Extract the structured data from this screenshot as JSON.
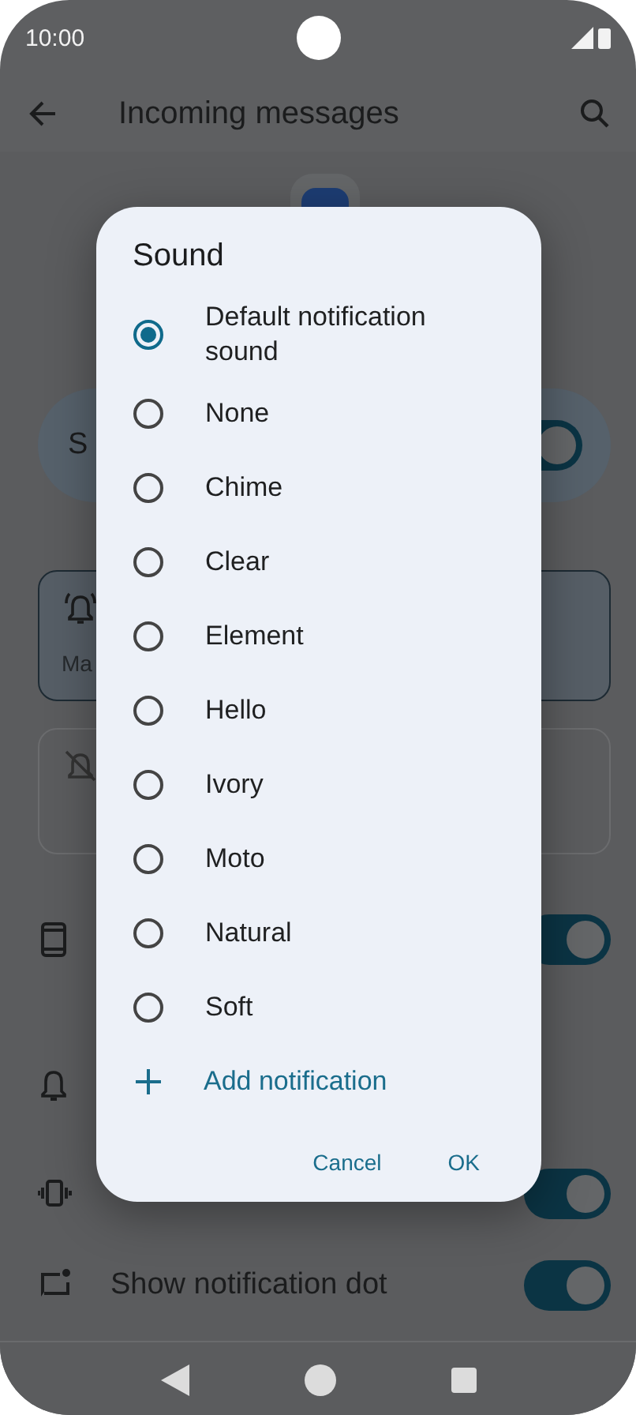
{
  "status_bar": {
    "time": "10:00"
  },
  "app_bar": {
    "title": "Incoming messages"
  },
  "settings": [
    {
      "kind": "pill",
      "label": "S",
      "on": true
    },
    {
      "kind": "card",
      "label": "Ma",
      "selected": true
    },
    {
      "kind": "card",
      "selected": false
    },
    {
      "kind": "row",
      "on": true
    },
    {
      "kind": "row"
    },
    {
      "kind": "row",
      "on": true
    },
    {
      "kind": "row",
      "label": "Show notification dot",
      "on": true
    }
  ],
  "dialog": {
    "title": "Sound",
    "options": [
      {
        "label": "Default notification sound",
        "selected": true
      },
      {
        "label": "None",
        "selected": false
      },
      {
        "label": "Chime",
        "selected": false
      },
      {
        "label": "Clear",
        "selected": false
      },
      {
        "label": "Element",
        "selected": false
      },
      {
        "label": "Hello",
        "selected": false
      },
      {
        "label": "Ivory",
        "selected": false
      },
      {
        "label": "Moto",
        "selected": false
      },
      {
        "label": "Natural",
        "selected": false
      },
      {
        "label": "Soft",
        "selected": false
      }
    ],
    "add_label": "Add notification",
    "buttons": [
      "Cancel",
      "OK"
    ]
  }
}
